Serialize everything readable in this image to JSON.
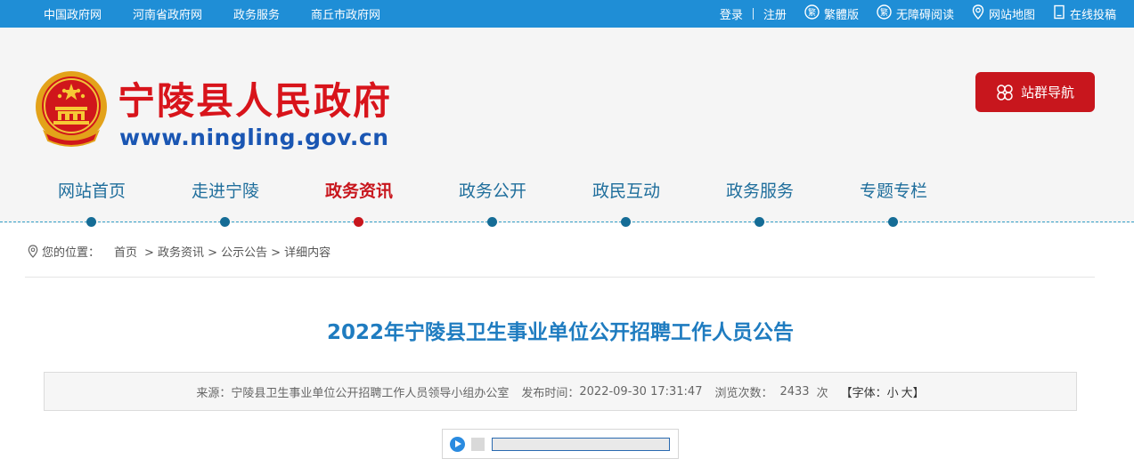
{
  "topbar": {
    "left_links": [
      "中国政府网",
      "河南省政府网",
      "政务服务",
      "商丘市政府网"
    ],
    "login": "登录",
    "register": "注册",
    "traditional": "繁體版",
    "traditional_badge": "繁",
    "accessible": "无障碍阅读",
    "accessible_badge": "繁",
    "sitemap": "网站地图",
    "submit": "在线投稿"
  },
  "header": {
    "site_title": "宁陵县人民政府",
    "site_url": "www.ningling.gov.cn",
    "site_nav_button": "站群导航"
  },
  "nav": {
    "items": [
      {
        "label": "网站首页",
        "active": false
      },
      {
        "label": "走进宁陵",
        "active": false
      },
      {
        "label": "政务资讯",
        "active": true
      },
      {
        "label": "政务公开",
        "active": false
      },
      {
        "label": "政民互动",
        "active": false
      },
      {
        "label": "政务服务",
        "active": false
      },
      {
        "label": "专题专栏",
        "active": false
      }
    ]
  },
  "breadcrumb": {
    "prefix": "您的位置：",
    "home": "首页",
    "level1": "> 政务资讯",
    "level2": "> 公示公告",
    "level3": "> 详细内容"
  },
  "article": {
    "title": "2022年宁陵县卫生事业单位公开招聘工作人员公告",
    "source_label": "来源：",
    "source": "宁陵县卫生事业单位公开招聘工作人员领导小组办公室",
    "publish_label": "发布时间：",
    "publish_time": "2022-09-30 17:31:47",
    "views_label": "浏览次数：",
    "views": "2433",
    "views_unit": "次",
    "font_label": "【字体：",
    "font_small": "小",
    "font_large": "大",
    "font_close": "】"
  },
  "colors": {
    "topbar_bg": "#1f8ed6",
    "brand_red": "#c8161d",
    "nav_blue": "#1f6e9c",
    "title_blue": "#1f7cc0",
    "url_blue": "#1a56b3"
  }
}
